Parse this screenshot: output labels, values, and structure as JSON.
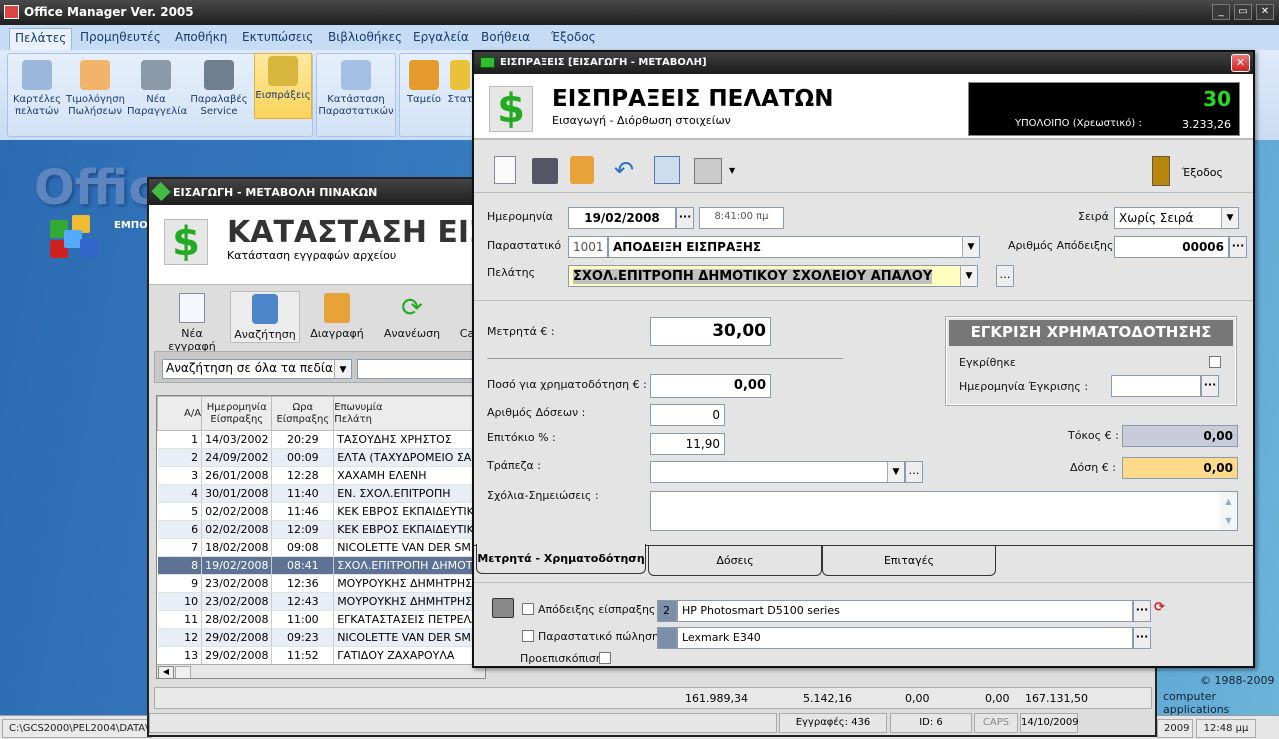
{
  "app": {
    "title": "Office Manager Ver. 2005",
    "window_controls": [
      "_",
      "▭",
      "✕"
    ]
  },
  "menu": [
    "Πελάτες",
    "Προμηθευτές",
    "Αποθήκη",
    "Εκτυπώσεις",
    "Βιβλιοθήκες",
    "Εργαλεία",
    "Βοήθεια",
    "Έξοδος"
  ],
  "ribbon": [
    {
      "l1": "Καρτέλες",
      "l2": "πελατών",
      "icon": "customer-card-icon"
    },
    {
      "l1": "Τιμολόγηση",
      "l2": "Πωλήσεων",
      "icon": "invoice-icon"
    },
    {
      "l1": "Νέα",
      "l2": "Παραγγελία",
      "icon": "cart-icon"
    },
    {
      "l1": "Παραλαβές",
      "l2": "Service",
      "icon": "tools-icon"
    },
    {
      "l1": "Εισπράξεις",
      "l2": "",
      "icon": "money-icon",
      "selected": true
    },
    {
      "l1": "Κατάσταση",
      "l2": "Παραστατικών",
      "icon": "list-icon"
    },
    {
      "l1": "Ταμείο",
      "l2": "",
      "icon": "cash-icon"
    },
    {
      "l1": "Στατ",
      "l2": "",
      "icon": "stats-icon"
    }
  ],
  "desktop": {
    "logo": "Office",
    "logo_sub": "ΕΜΠΟ",
    "copyright": "© 1988-2009",
    "company": "computer applications"
  },
  "taskbar": {
    "path": "C:\\GCS2000\\PEL2004\\DATA\\",
    "year": "2009",
    "time": "12:48 μμ"
  },
  "back_window": {
    "title": "ΕΙΣΑΓΩΓΗ - ΜΕΤΑΒΟΛΗ ΠΙΝΑΚΩΝ",
    "heading": "ΚΑΤΑΣΤΑΣΗ ΕΙΣΠΙ",
    "subheading": "Κατάσταση εγγραφών αρχείου",
    "toolbar": [
      "Νέα εγγραφή",
      "Αναζήτηση",
      "Διαγραφή",
      "Ανανέωση",
      "Ca"
    ],
    "search_scope": "Αναζήτηση σε όλα τα πεδία",
    "columns": [
      [
        "Α/Α",
        ""
      ],
      [
        "Ημερομηνία",
        "Είσπραξης"
      ],
      [
        "Ωρα",
        "Είσπραξης"
      ],
      [
        "Επωνυμία",
        "Πελάτη"
      ]
    ],
    "rows": [
      [
        "1",
        "14/03/2002",
        "20:29",
        "ΤΑΣΟΥΔΗΣ ΧΡΗΣΤΟΣ"
      ],
      [
        "2",
        "24/09/2002",
        "00:09",
        "ΕΛΤΑ (ΤΑΧΥΔΡΟΜΕΙΟ ΣΑΜ"
      ],
      [
        "3",
        "26/01/2008",
        "12:28",
        "ΧΑΧΑΜΗ ΕΛΕΝΗ"
      ],
      [
        "4",
        "30/01/2008",
        "11:40",
        "ΕΝ. ΣΧΟΛ.ΕΠΙΤΡΟΠΗ"
      ],
      [
        "5",
        "02/02/2008",
        "11:46",
        "ΚΕΚ ΕΒΡΟΣ ΕΚΠΑΙΔΕΥΤΙΚΗ"
      ],
      [
        "6",
        "02/02/2008",
        "12:09",
        "ΚΕΚ ΕΒΡΟΣ ΕΚΠΑΙΔΕΥΤΙΚΗ"
      ],
      [
        "7",
        "18/02/2008",
        "09:08",
        "NICOLETTE VAN DER SMIS"
      ],
      [
        "8",
        "19/02/2008",
        "08:41",
        "ΣΧΟΛ.ΕΠΙΤΡΟΠΗ ΔΗΜΟΤΙΚ"
      ],
      [
        "9",
        "23/02/2008",
        "12:36",
        "ΜΟΥΡΟΥΚΗΣ ΔΗΜΗΤΡΗΣ"
      ],
      [
        "10",
        "23/02/2008",
        "12:43",
        "ΜΟΥΡΟΥΚΗΣ ΔΗΜΗΤΡΗΣ"
      ],
      [
        "11",
        "28/02/2008",
        "11:00",
        "ΕΓΚΑΤΑΣΤΑΣΕΙΣ ΠΕΤΡΕΛΑΙ"
      ],
      [
        "12",
        "29/02/2008",
        "09:23",
        "NICOLETTE VAN DER SMIS"
      ],
      [
        "13",
        "29/02/2008",
        "11:52",
        "ΓΑΤΙΔΟΥ ΖΑΧΑΡΟΥΛΑ"
      ]
    ],
    "selected_row": 8,
    "totals": [
      "161.989,34",
      "5.142,16",
      "0,00",
      "0,00",
      "167.131,50"
    ],
    "status": {
      "records": "Εγγραφές: 436",
      "id": "ID: 6",
      "caps": "CAPS",
      "date": "14/10/2009"
    }
  },
  "front_window": {
    "title": "ΕΙΣΠΡΑΞΕΙΣ [ΕΙΣΑΓΩΓΗ - ΜΕΤΑΒΟΛΗ]",
    "heading": "ΕΙΣΠΡΑΞΕΙΣ ΠΕΛΑΤΩΝ",
    "subheading": "Εισαγωγή - Διόρθωση στοιχείων",
    "counter": "30",
    "balance_label": "ΥΠΟΛΟΙΠΟ (Χρεωστικό) :",
    "balance": "3.233,26",
    "exit_label": "Έξοδος",
    "date_label": "Ημερομηνία",
    "date": "19/02/2008",
    "time": "8:41:00 πμ",
    "series_label": "Σειρά",
    "series": "Χωρίς Σειρά",
    "doc_label": "Παραστατικό",
    "doc_code": "1001",
    "doc": "ΑΠΟΔΕΙΞΗ ΕΙΣΠΡΑΞΗΣ",
    "receipt_no_label": "Αριθμός Απόδειξης",
    "receipt_no": "00006",
    "customer_label": "Πελάτης",
    "customer": "ΣΧΟΛ.ΕΠΙΤΡΟΠΗ ΔΗΜΟΤΙΚΟΥ ΣΧΟΛΕΙΟΥ ΑΠΑΛΟΥ",
    "cash_label": "Μετρητά € :",
    "cash": "30,00",
    "finance_label": "Ποσό για χρηματοδότηση € :",
    "finance": "0,00",
    "installments_label": "Αριθμός Δόσεων :",
    "installments": "0",
    "rate_label": "Επιτόκιο %  :",
    "rate": "11,90",
    "bank_label": "Τράπεζα :",
    "bank": "",
    "notes_label": "Σχόλια-Σημειώσεις :",
    "notes": "",
    "approval": {
      "title": "ΕΓΚΡΙΣΗ ΧΡΗΜΑΤΟΔΟΤΗΣΗΣ",
      "approved_label": "Εγκρίθηκε",
      "approved": false,
      "date_label": "Ημερομηνία Έγκρισης :",
      "date": ""
    },
    "interest_label": "Τόκος € :",
    "interest": "0,00",
    "installment_label": "Δόση  € :",
    "installment": "0,00",
    "tabs": [
      "Μετρητά - Χρηματοδότηση",
      "Δόσεις",
      "Επιταγές"
    ],
    "active_tab": 0,
    "print": {
      "receipt_label": "Απόδειξης είσπραξης :",
      "receipt_copies": "2",
      "receipt_printer": "HP Photosmart D5100 series",
      "sales_label": "Παραστατικό πώλησης :",
      "sales_copies": "",
      "sales_printer": "Lexmark E340",
      "preview_label": "Προεπισκόπιση"
    },
    "colors": {
      "counter": "#22dd22",
      "interest_bg": "#c9cbd8",
      "installment_bg": "#fdd98a",
      "customer_bg": "#ffffc0"
    }
  }
}
